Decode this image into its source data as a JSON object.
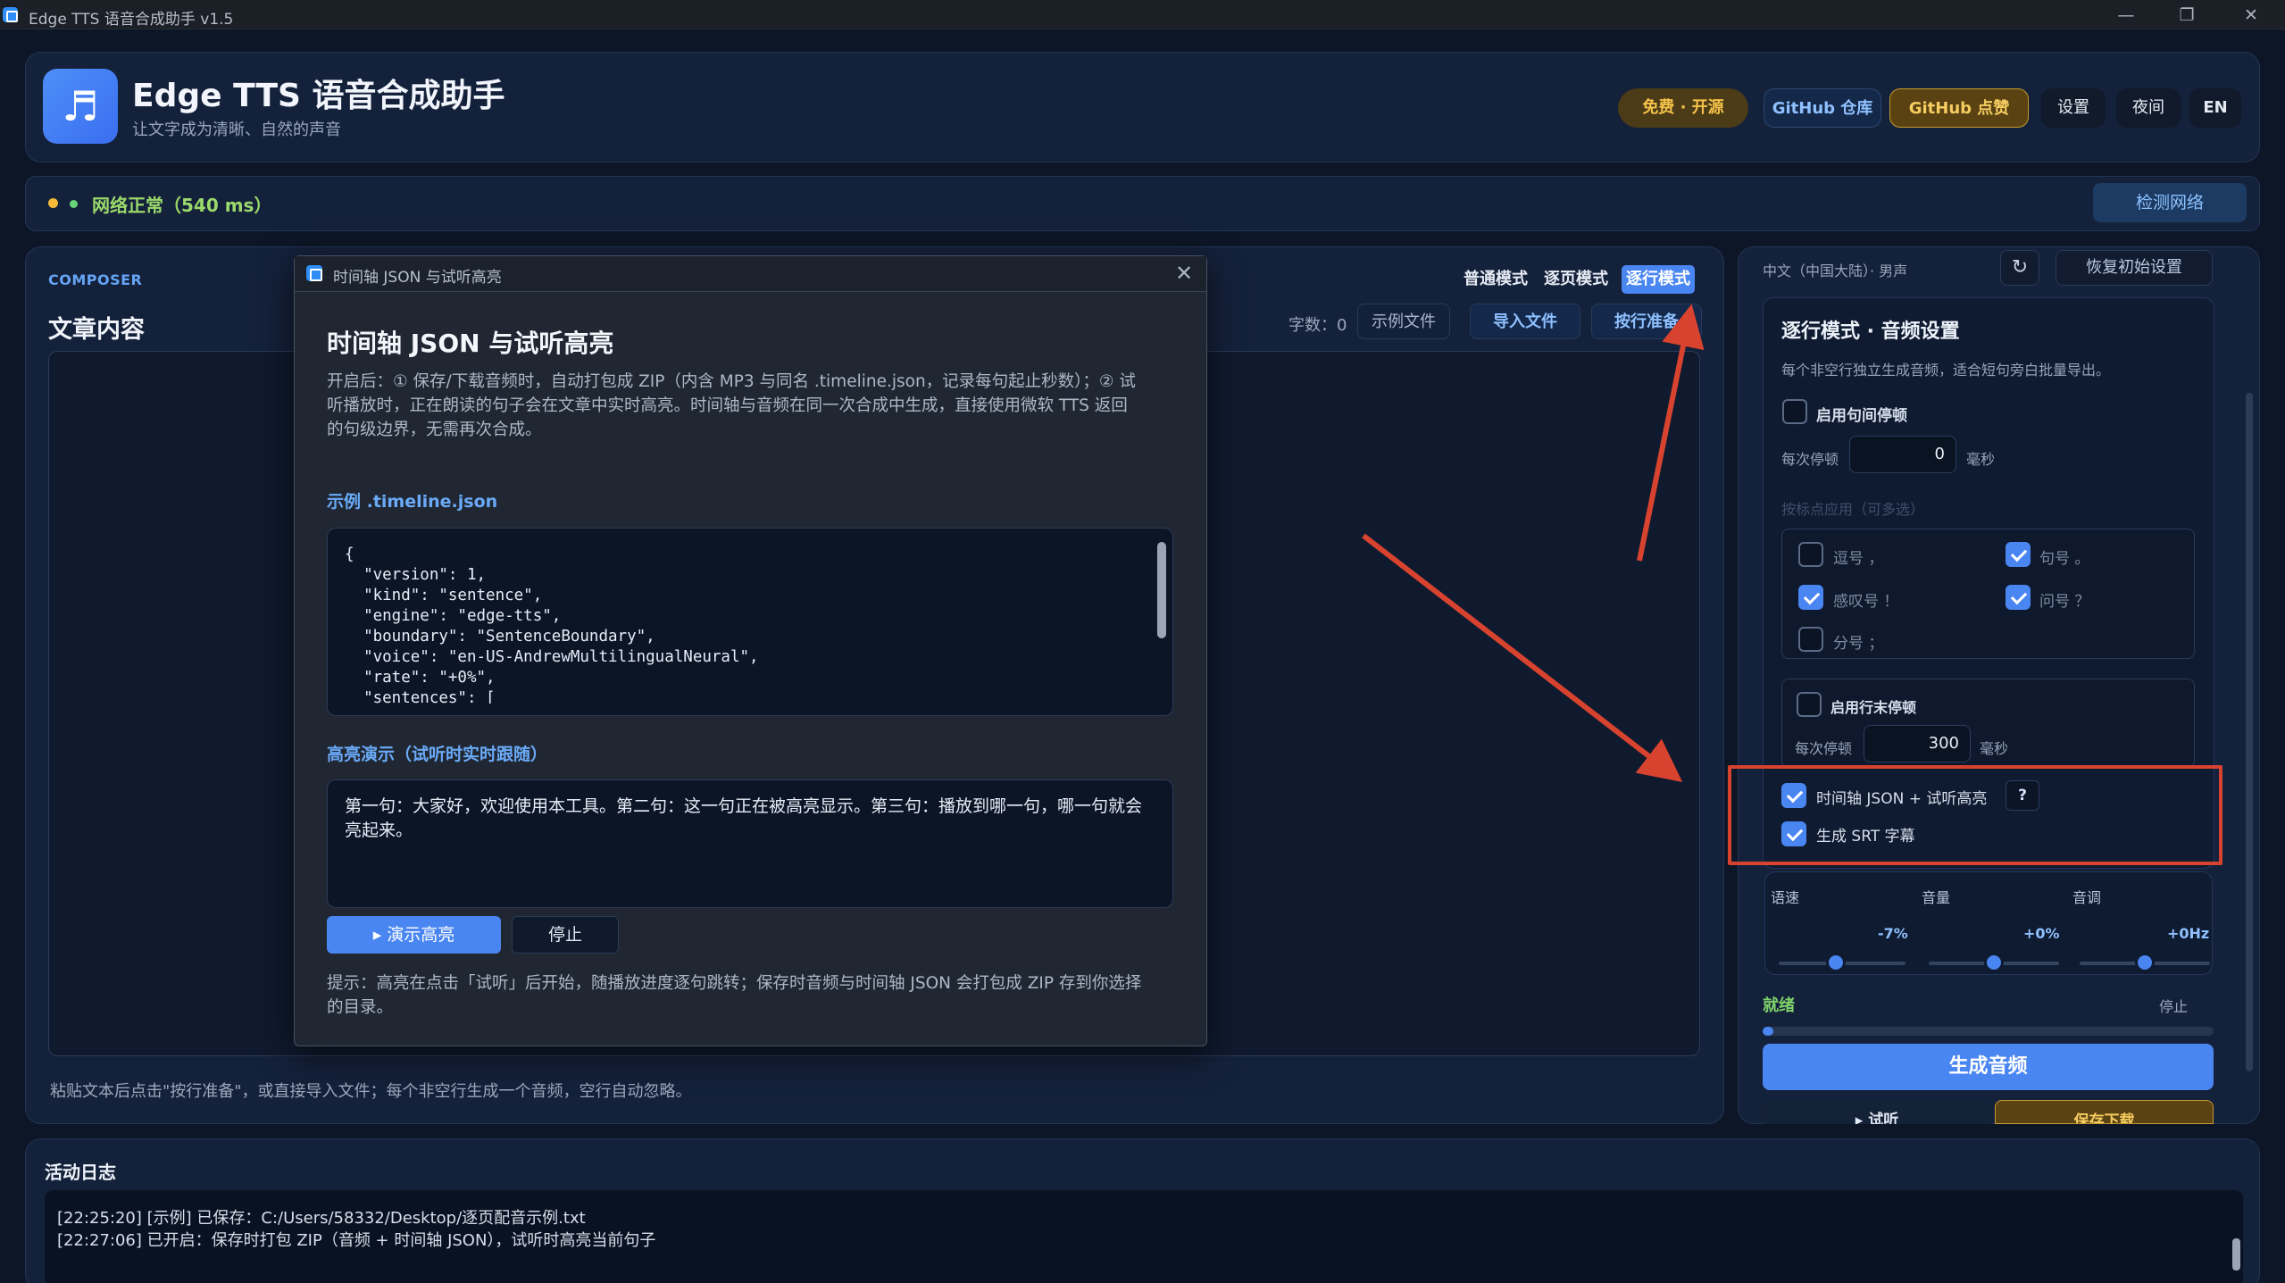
{
  "window": {
    "title": "Edge TTS 语音合成助手 v1.5",
    "minimize": "—",
    "restore": "❐",
    "close": "✕"
  },
  "header": {
    "logo_glyph": "♬",
    "title": "Edge TTS 语音合成助手",
    "subtitle": "让文字成为清晰、自然的声音",
    "buttons": {
      "free": "免费 · 开源",
      "repo": "GitHub 仓库",
      "star": "GitHub 点赞",
      "settings": "设置",
      "night": "夜间",
      "lang": "EN"
    }
  },
  "network": {
    "status": "网络正常（540 ms）",
    "check_button": "检测网络"
  },
  "composer": {
    "label": "COMPOSER",
    "title": "文章内容",
    "modes": [
      "普通模式",
      "逐页模式",
      "逐行模式"
    ],
    "active_mode": "逐行模式",
    "word_count": "字数：0",
    "example_file": "示例文件",
    "import_file": "导入文件",
    "prepare_lines": "按行准备",
    "hint": "粘贴文本后点击\"按行准备\"，或直接导入文件；每个非空行生成一个音频，空行自动忽略。"
  },
  "right_panel": {
    "voice": "中文（中国大陆）· 男声",
    "refresh_icon": "↻",
    "reset_button": "恢复初始设置",
    "settings_title": "逐行模式 · 音频设置",
    "settings_sub": "每个非空行独立生成音频，适合短句旁白批量导出。",
    "sentence_pause": {
      "label": "启用句间停顿",
      "checked": false,
      "each_label": "每次停顿",
      "value": "0",
      "unit": "毫秒"
    },
    "punct_label": "按标点应用（可多选）",
    "punctuation": [
      {
        "label": "逗号 ，",
        "checked": false
      },
      {
        "label": "句号 。",
        "checked": true
      },
      {
        "label": "感叹号 ！",
        "checked": true
      },
      {
        "label": "问号 ？",
        "checked": true
      },
      {
        "label": "分号 ；",
        "checked": false
      }
    ],
    "line_end_pause": {
      "label": "启用行末停顿",
      "checked": false,
      "each_label": "每次停顿",
      "value": "300",
      "unit": "毫秒"
    },
    "timeline": {
      "label": "时间轴 JSON + 试听高亮",
      "checked": true,
      "help": "?"
    },
    "srt": {
      "label": "生成 SRT 字幕",
      "checked": true
    },
    "sliders": [
      {
        "label": "语速",
        "value": "-7%",
        "level": 0.45
      },
      {
        "label": "音量",
        "value": "+0%",
        "level": 0.5
      },
      {
        "label": "音调",
        "value": "+0Hz",
        "level": 0.5
      }
    ],
    "status": "就绪",
    "stop_label": "停止",
    "progress": 0.02,
    "generate_button": "生成音频",
    "listen_button": "▸ 试听",
    "save_button": "保存下载"
  },
  "log": {
    "title": "活动日志",
    "lines": [
      "[22:25:20] [示例] 已保存：C:/Users/58332/Desktop/逐页配音示例.txt",
      "[22:27:06] 已开启：保存时打包 ZIP（音频 + 时间轴 JSON），试听时高亮当前句子"
    ]
  },
  "modal": {
    "bar_title": "时间轴 JSON 与试听高亮",
    "close": "✕",
    "heading": "时间轴 JSON 与试听高亮",
    "description": "开启后：① 保存/下载音频时，自动打包成 ZIP（内含 MP3 与同名 .timeline.json，记录每句起止秒数）；② 试听播放时，正在朗读的句子会在文章中实时高亮。时间轴与音频在同一次合成中生成，直接使用微软 TTS 返回的句级边界，无需再次合成。",
    "example_title": "示例 .timeline.json",
    "code": "{\n  \"version\": 1,\n  \"kind\": \"sentence\",\n  \"engine\": \"edge-tts\",\n  \"boundary\": \"SentenceBoundary\",\n  \"voice\": \"en-US-AndrewMultilingualNeural\",\n  \"rate\": \"+0%\",\n  \"sentences\": [",
    "highlight_title": "高亮演示（试听时实时跟随）",
    "highlight_text": "第一句：大家好，欢迎使用本工具。第二句：这一句正在被高亮显示。第三句：播放到哪一句，哪一句就会亮起来。",
    "demo_button": "▸ 演示高亮",
    "stop_button": "停止",
    "tip": "提示：高亮在点击「试听」后开始，随播放进度逐句跳转；保存时音频与时间轴 JSON 会打包成 ZIP 存到你选择的目录。"
  },
  "colors": {
    "accent": "#4a86f2",
    "annotation_red": "#d8432f",
    "ready_green": "#7fd36a",
    "gold": "#f6cd61"
  }
}
